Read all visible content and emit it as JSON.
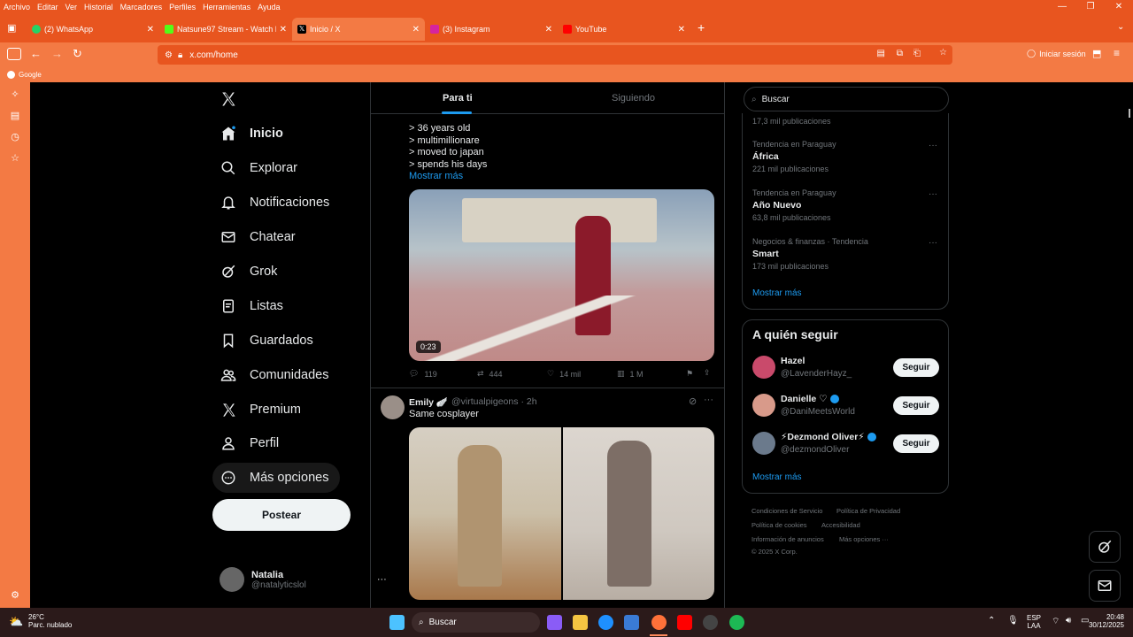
{
  "browser": {
    "menu": [
      "Archivo",
      "Editar",
      "Ver",
      "Historial",
      "Marcadores",
      "Perfiles",
      "Herramientas",
      "Ayuda"
    ],
    "tabs": [
      {
        "title": "(2) WhatsApp",
        "color": "#25d366",
        "icon_text": "2"
      },
      {
        "title": "Natsune97 Stream - Watch Live",
        "color": "#53fc18",
        "icon_text": "K"
      },
      {
        "title": "Inicio / X",
        "color": "#000000",
        "icon_text": "X"
      },
      {
        "title": "(3) Instagram",
        "color": "#d6249f",
        "icon_text": ""
      },
      {
        "title": "YouTube",
        "color": "#ff0000",
        "icon_text": "▶"
      }
    ],
    "url": "x.com/home",
    "signin_label": "Iniciar sesión",
    "bookmark": "Google"
  },
  "nav": {
    "items": [
      {
        "label": "Inicio",
        "icon": "home-icon"
      },
      {
        "label": "Explorar",
        "icon": "search-icon"
      },
      {
        "label": "Notificaciones",
        "icon": "bell-icon"
      },
      {
        "label": "Chatear",
        "icon": "mail-icon"
      },
      {
        "label": "Grok",
        "icon": "grok-icon"
      },
      {
        "label": "Listas",
        "icon": "list-icon"
      },
      {
        "label": "Guardados",
        "icon": "bookmark-icon"
      },
      {
        "label": "Comunidades",
        "icon": "people-icon"
      },
      {
        "label": "Premium",
        "icon": "x-logo-icon"
      },
      {
        "label": "Perfil",
        "icon": "person-icon"
      },
      {
        "label": "Más opciones",
        "icon": "more-circle-icon"
      }
    ],
    "post_button": "Postear",
    "user": {
      "name": "Natalia",
      "handle": "@natalyticslol"
    }
  },
  "feed": {
    "tabs": [
      "Para ti",
      "Siguiendo"
    ],
    "post1": {
      "lines": [
        "> 36 years old",
        "> multimillionare",
        "> moved to japan",
        "> spends his days"
      ],
      "show_more": "Mostrar más",
      "video_duration": "0:23",
      "replies": "119",
      "reposts": "444",
      "likes": "14 mil",
      "views": "1 M"
    },
    "post2": {
      "name": "Emily 🪽",
      "handle": "@virtualpigeons",
      "time": "· 2h",
      "text": "Same cosplayer"
    }
  },
  "sidebar": {
    "search_placeholder": "Buscar",
    "trends": [
      {
        "meta": "",
        "name": "",
        "count": "17,3 mil publicaciones"
      },
      {
        "meta": "Tendencia en Paraguay",
        "name": "África",
        "count": "221 mil publicaciones"
      },
      {
        "meta": "Tendencia en Paraguay",
        "name": "Año Nuevo",
        "count": "63,8 mil publicaciones"
      },
      {
        "meta": "Negocios & finanzas · Tendencia",
        "name": "Smart",
        "count": "173 mil publicaciones"
      }
    ],
    "trends_show_more": "Mostrar más",
    "who_to_follow_title": "A quién seguir",
    "who_to_follow": [
      {
        "name": "Hazel",
        "handle": "@LavenderHayz_",
        "button": "Seguir",
        "avatar_color": "#c94a6b"
      },
      {
        "name": "Danielle ♡",
        "handle": "@DaniMeetsWorld",
        "button": "Seguir",
        "avatar_color": "#d89a8a"
      },
      {
        "name": "⚡Dezmond Oliver⚡",
        "handle": "@dezmondOliver",
        "button": "Seguir",
        "avatar_color": "#6b7a8c"
      }
    ],
    "follow_show_more": "Mostrar más",
    "footer": [
      "Condiciones de Servicio",
      "Política de Privacidad",
      "Política de cookies",
      "Accesibilidad",
      "Información de anuncios",
      "Más opciones ···",
      "© 2025 X Corp."
    ]
  },
  "taskbar": {
    "weather_temp": "26°C",
    "weather_desc": "Parc. nublado",
    "search": "Buscar",
    "lang1": "ESP",
    "lang2": "LAA",
    "time": "20:48",
    "date": "30/12/2025"
  }
}
